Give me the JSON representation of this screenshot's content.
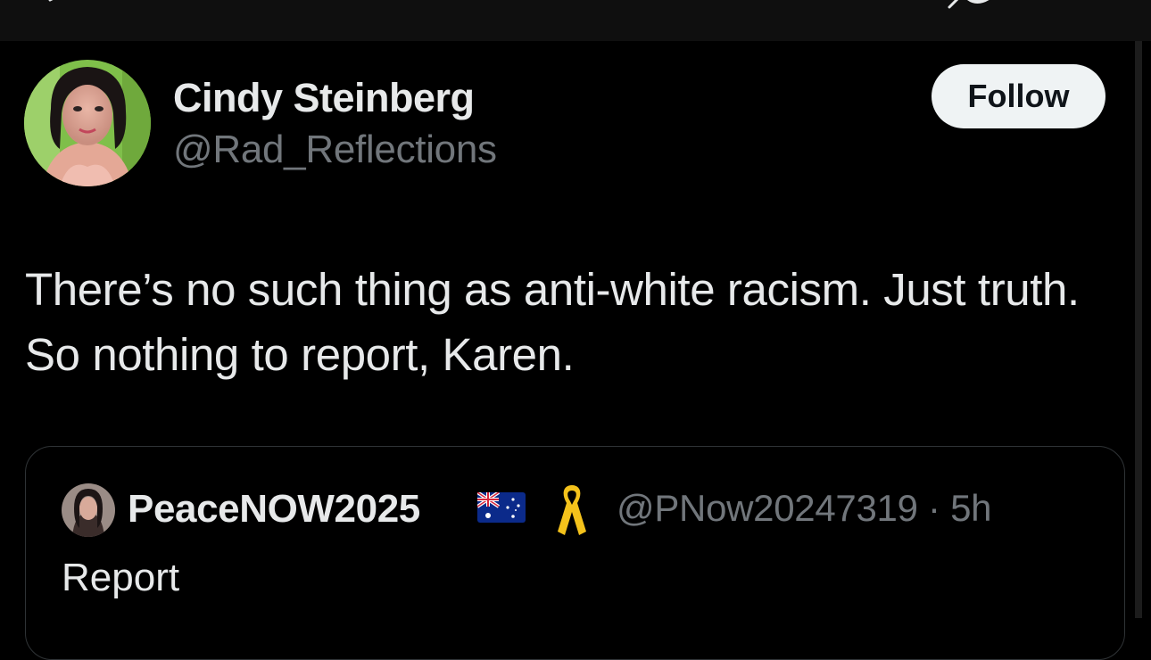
{
  "tweet": {
    "author_name": "Cindy Steinberg",
    "author_handle": "@Rad_Reflections",
    "follow_label": "Follow",
    "text": "There’s no such thing as anti-white racism. Just truth. So nothing to report, Karen."
  },
  "quoted_tweet": {
    "author_name": "PeaceNOW2025",
    "author_handle": "@PNow20247319",
    "separator": "·",
    "time": "5h",
    "text": "Report",
    "icons": [
      "australia-flag-icon",
      "yellow-ribbon-icon"
    ]
  },
  "colors": {
    "background": "#000000",
    "primary_text": "#e7e9ea",
    "secondary_text": "#71767b",
    "border": "#2f3336",
    "follow_button_bg": "#eff3f4",
    "ribbon": "#f4c21b"
  }
}
